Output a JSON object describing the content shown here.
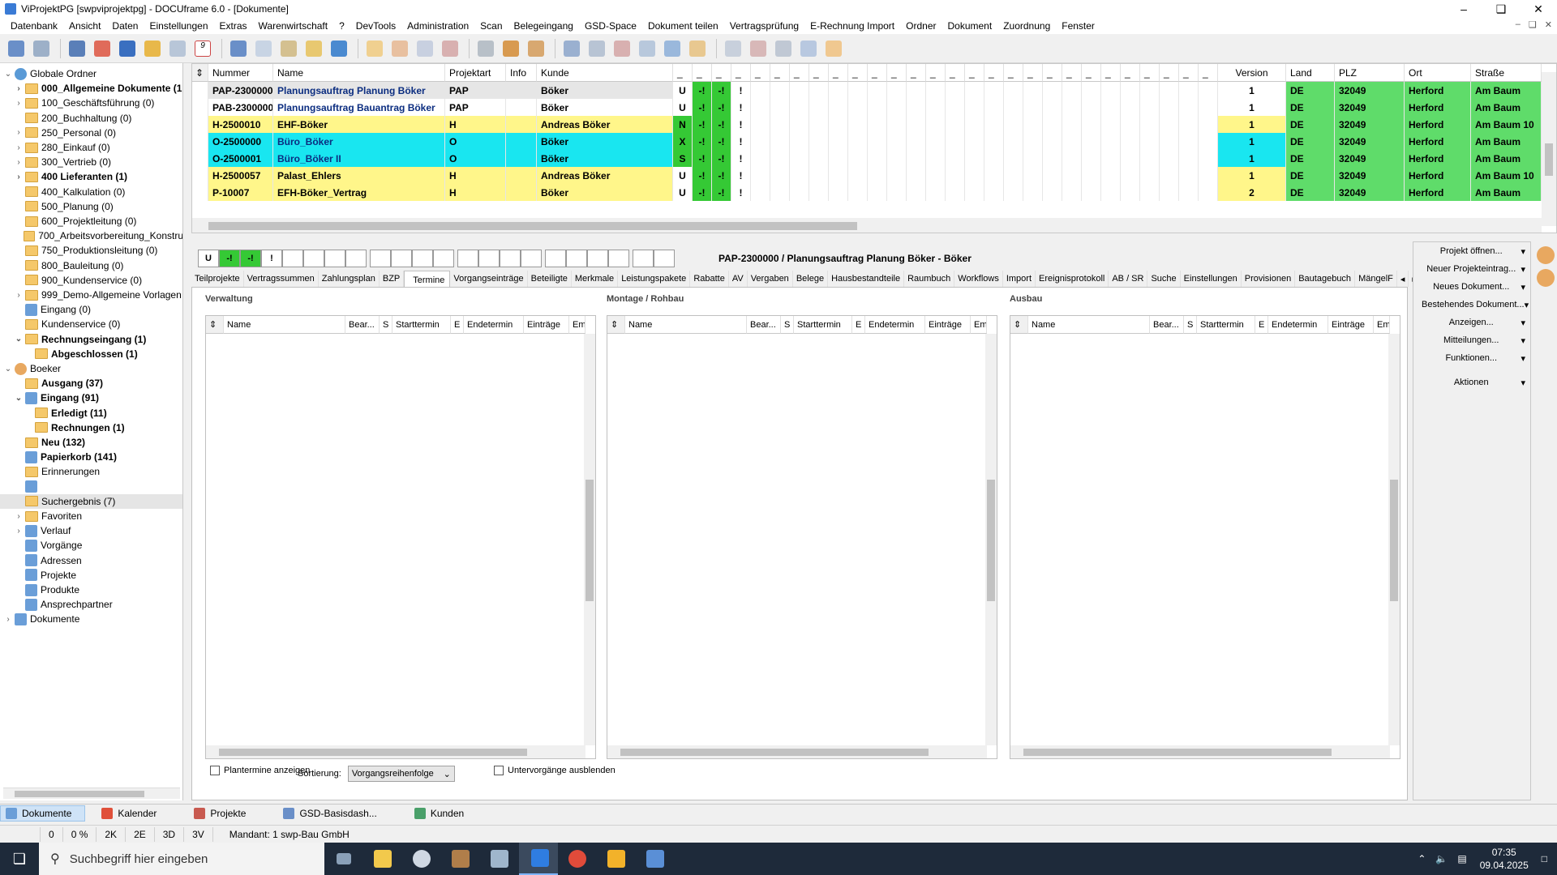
{
  "window": {
    "title": "ViProjektPG [swpviprojektpg] - DOCUframe 6.0 - [Dokumente]"
  },
  "menu": [
    "Datenbank",
    "Ansicht",
    "Daten",
    "Einstellungen",
    "Extras",
    "Warenwirtschaft",
    "?",
    "DevTools",
    "Administration",
    "Scan",
    "Belegeingang",
    "GSD-Space",
    "Dokument teilen",
    "Vertragsprüfung",
    "E-Rechnung Import",
    "Ordner",
    "Dokument",
    "Zuordnung",
    "Fenster"
  ],
  "tree": [
    {
      "label": "Globale Ordner",
      "level": 0,
      "exp": "v",
      "icon": "globe",
      "bold": false
    },
    {
      "label": "000_Allgemeine Dokumente (1",
      "level": 1,
      "exp": ">",
      "icon": "folder",
      "bold": true
    },
    {
      "label": "100_Geschäftsführung (0)",
      "level": 1,
      "exp": ">",
      "icon": "folder",
      "bold": false
    },
    {
      "label": "200_Buchhaltung (0)",
      "level": 1,
      "exp": "",
      "icon": "folder",
      "bold": false
    },
    {
      "label": "250_Personal (0)",
      "level": 1,
      "exp": ">",
      "icon": "folder",
      "bold": false
    },
    {
      "label": "280_Einkauf (0)",
      "level": 1,
      "exp": ">",
      "icon": "folder",
      "bold": false
    },
    {
      "label": "300_Vertrieb (0)",
      "level": 1,
      "exp": ">",
      "icon": "folder",
      "bold": false
    },
    {
      "label": "400 Lieferanten (1)",
      "level": 1,
      "exp": ">",
      "icon": "folder",
      "bold": true
    },
    {
      "label": "400_Kalkulation (0)",
      "level": 1,
      "exp": "",
      "icon": "folder",
      "bold": false
    },
    {
      "label": "500_Planung (0)",
      "level": 1,
      "exp": "",
      "icon": "folder",
      "bold": false
    },
    {
      "label": "600_Projektleitung (0)",
      "level": 1,
      "exp": "",
      "icon": "folder",
      "bold": false
    },
    {
      "label": "700_Arbeitsvorbereitung_Konstru",
      "level": 1,
      "exp": "",
      "icon": "folder",
      "bold": false
    },
    {
      "label": "750_Produktionsleitung (0)",
      "level": 1,
      "exp": "",
      "icon": "folder",
      "bold": false
    },
    {
      "label": "800_Bauleitung (0)",
      "level": 1,
      "exp": "",
      "icon": "folder",
      "bold": false
    },
    {
      "label": "900_Kundenservice (0)",
      "level": 1,
      "exp": "",
      "icon": "folder",
      "bold": false
    },
    {
      "label": "999_Demo-Allgemeine Vorlagen",
      "level": 1,
      "exp": ">",
      "icon": "folder",
      "bold": false
    },
    {
      "label": "Eingang (0)",
      "level": 1,
      "exp": "",
      "icon": "other",
      "bold": false
    },
    {
      "label": "Kundenservice (0)",
      "level": 1,
      "exp": "",
      "icon": "folder",
      "bold": false
    },
    {
      "label": "Rechnungseingang (1)",
      "level": 1,
      "exp": "v",
      "icon": "folder",
      "bold": true
    },
    {
      "label": "Abgeschlossen (1)",
      "level": 2,
      "exp": "",
      "icon": "folder",
      "bold": true
    },
    {
      "label": "Boeker",
      "level": 0,
      "exp": "v",
      "icon": "user",
      "bold": false
    },
    {
      "label": "Ausgang (37)",
      "level": 1,
      "exp": "",
      "icon": "folder",
      "bold": true
    },
    {
      "label": "Eingang (91)",
      "level": 1,
      "exp": "v",
      "icon": "other",
      "bold": true
    },
    {
      "label": "Erledigt (11)",
      "level": 2,
      "exp": "",
      "icon": "folder",
      "bold": true
    },
    {
      "label": "Rechnungen (1)",
      "level": 2,
      "exp": "",
      "icon": "folder",
      "bold": true
    },
    {
      "label": "Neu (132)",
      "level": 1,
      "exp": "",
      "icon": "folder",
      "bold": true
    },
    {
      "label": "Papierkorb (141)",
      "level": 1,
      "exp": "",
      "icon": "other",
      "bold": true
    },
    {
      "label": "Erinnerungen",
      "level": 1,
      "exp": "",
      "icon": "folder",
      "bold": false
    },
    {
      "label": "",
      "level": 1,
      "exp": "",
      "icon": "other",
      "bold": false
    },
    {
      "label": "Suchergebnis (7)",
      "level": 1,
      "exp": "",
      "icon": "folder",
      "bold": false,
      "selected": true
    },
    {
      "label": "Favoriten",
      "level": 1,
      "exp": ">",
      "icon": "folder",
      "bold": false
    },
    {
      "label": "Verlauf",
      "level": 1,
      "exp": ">",
      "icon": "other",
      "bold": false
    },
    {
      "label": "Vorgänge",
      "level": 1,
      "exp": "",
      "icon": "other",
      "bold": false
    },
    {
      "label": "Adressen",
      "level": 1,
      "exp": "",
      "icon": "other",
      "bold": false
    },
    {
      "label": "Projekte",
      "level": 1,
      "exp": "",
      "icon": "other",
      "bold": false
    },
    {
      "label": "Produkte",
      "level": 1,
      "exp": "",
      "icon": "other",
      "bold": false
    },
    {
      "label": "Ansprechpartner",
      "level": 1,
      "exp": "",
      "icon": "other",
      "bold": false
    },
    {
      "label": "Dokumente",
      "level": 0,
      "exp": ">",
      "icon": "other",
      "bold": false
    }
  ],
  "grid": {
    "headers": {
      "nummer": "Nummer",
      "name": "Name",
      "projektart": "Projektart",
      "info": "Info",
      "kunde": "Kunde",
      "dash": "_",
      "version": "Version",
      "land": "Land",
      "plz": "PLZ",
      "ort": "Ort",
      "strasse": "Straße"
    },
    "rows": [
      {
        "nummer": "PAP-2300000",
        "name": "Planungsauftrag Planung Böker",
        "projektart": "PAP",
        "kunde": "Böker",
        "status": "U",
        "flag1": "-!",
        "flag2": "-!",
        "excl": "!",
        "version": "1",
        "land": "DE",
        "plz": "32049",
        "ort": "Herford",
        "strasse": "Am Baum",
        "row_color": "#e6e6e6",
        "num_color": "#e6e6e6",
        "status_color": "#ffffff",
        "version_color": "#ffffff",
        "name_blue": true
      },
      {
        "nummer": "PAB-2300000",
        "name": "Planungsauftrag Bauantrag Böker",
        "projektart": "PAP",
        "kunde": "Böker",
        "status": "U",
        "flag1": "-!",
        "flag2": "-!",
        "excl": "!",
        "version": "1",
        "land": "DE",
        "plz": "32049",
        "ort": "Herford",
        "strasse": "Am Baum",
        "row_color": "#ffffff",
        "num_color": "#ffffff",
        "status_color": "#ffffff",
        "version_color": "#ffffff",
        "name_blue": true
      },
      {
        "nummer": "H-2500010",
        "name": "EHF-Böker",
        "projektart": "H",
        "kunde": "Andreas Böker",
        "status": "N",
        "flag1": "-!",
        "flag2": "-!",
        "excl": "!",
        "version": "1",
        "land": "DE",
        "plz": "32049",
        "ort": "Herford",
        "strasse": "Am Baum 10",
        "row_color": "#fff68a",
        "num_color": "#fff68a",
        "status_color": "#35c935",
        "version_color": "#fff68a",
        "name_blue": false
      },
      {
        "nummer": "O-2500000",
        "name": "Büro_Böker",
        "projektart": "O",
        "kunde": "Böker",
        "status": "X",
        "flag1": "-!",
        "flag2": "-!",
        "excl": "!",
        "version": "1",
        "land": "DE",
        "plz": "32049",
        "ort": "Herford",
        "strasse": "Am Baum",
        "row_color": "#19e6f0",
        "num_color": "#19e6f0",
        "status_color": "#35c935",
        "version_color": "#19e6f0",
        "name_blue": true
      },
      {
        "nummer": "O-2500001",
        "name": "Büro_Böker II",
        "projektart": "O",
        "kunde": "Böker",
        "status": "S",
        "flag1": "-!",
        "flag2": "-!",
        "excl": "!",
        "version": "1",
        "land": "DE",
        "plz": "32049",
        "ort": "Herford",
        "strasse": "Am Baum",
        "row_color": "#19e6f0",
        "num_color": "#19e6f0",
        "status_color": "#35c935",
        "version_color": "#19e6f0",
        "name_blue": true
      },
      {
        "nummer": "H-2500057",
        "name": "Palast_Ehlers",
        "projektart": "H",
        "kunde": "Andreas Böker",
        "status": "U",
        "flag1": "-!",
        "flag2": "-!",
        "excl": "!",
        "version": "1",
        "land": "DE",
        "plz": "32049",
        "ort": "Herford",
        "strasse": "Am Baum 10",
        "row_color": "#fff68a",
        "num_color": "#fff68a",
        "status_color": "#ffffff",
        "version_color": "#fff68a",
        "name_blue": false
      },
      {
        "nummer": "P-10007",
        "name": "EFH-Böker_Vertrag",
        "projektart": "H",
        "kunde": "Böker",
        "status": "U",
        "flag1": "-!",
        "flag2": "-!",
        "excl": "!",
        "version": "2",
        "land": "DE",
        "plz": "32049",
        "ort": "Herford",
        "strasse": "Am Baum",
        "row_color": "#fff68a",
        "num_color": "#fff68a",
        "status_color": "#ffffff",
        "version_color": "#fff68a",
        "name_blue": false
      }
    ]
  },
  "detail": {
    "status_boxes": [
      "U",
      "-!",
      "-!",
      "!"
    ],
    "title": "PAP-2300000 / Planungsauftrag Planung Böker - Böker",
    "tabs": [
      "Teilprojekte",
      "Vertragssummen",
      "Zahlungsplan",
      "BZP",
      "Termine",
      "Vorgangseinträge",
      "Beteiligte",
      "Merkmale",
      "Leistungspakete",
      "Rabatte",
      "AV",
      "Vergaben",
      "Belege",
      "Hausbestandteile",
      "Raumbuch",
      "Workflows",
      "Import",
      "Ereignisprotokoll",
      "AB / SR",
      "Suche",
      "Einstellungen",
      "Provisionen",
      "Bautagebuch",
      "MängelF"
    ],
    "active_tab": "Termine",
    "panes": [
      {
        "label": "Verwaltung"
      },
      {
        "label": "Montage / Rohbau"
      },
      {
        "label": "Ausbau"
      }
    ],
    "pane_headers": [
      "Name",
      "Bear...",
      "S",
      "Starttermin",
      "E",
      "Endetermin",
      "Einträge",
      "Emp"
    ],
    "options": {
      "plantermine": "Plantermine anzeigen",
      "sortierung_label": "Sortierung:",
      "sortierung_value": "Vorgangsreihenfolge",
      "untervorgaenge": "Untervorgänge ausblenden"
    }
  },
  "actions": [
    "Projekt öffnen...",
    "Neuer Projekteintrag...",
    "Neues Dokument...",
    "Bestehendes Dokument...",
    "Anzeigen...",
    "Mitteilungen...",
    "Funktionen...",
    "Aktionen"
  ],
  "bottom_tabs": [
    "Dokumente",
    "Kalender",
    "Projekte",
    "GSD-Basisdash...",
    "Kunden"
  ],
  "statusbar": [
    "0",
    "0 %",
    "2K",
    "2E",
    "3D",
    "3V",
    "Mandant: 1 swp-Bau GmbH"
  ],
  "taskbar": {
    "search_placeholder": "Suchbegriff hier eingeben",
    "time": "07:35",
    "date": "09.04.2025"
  }
}
